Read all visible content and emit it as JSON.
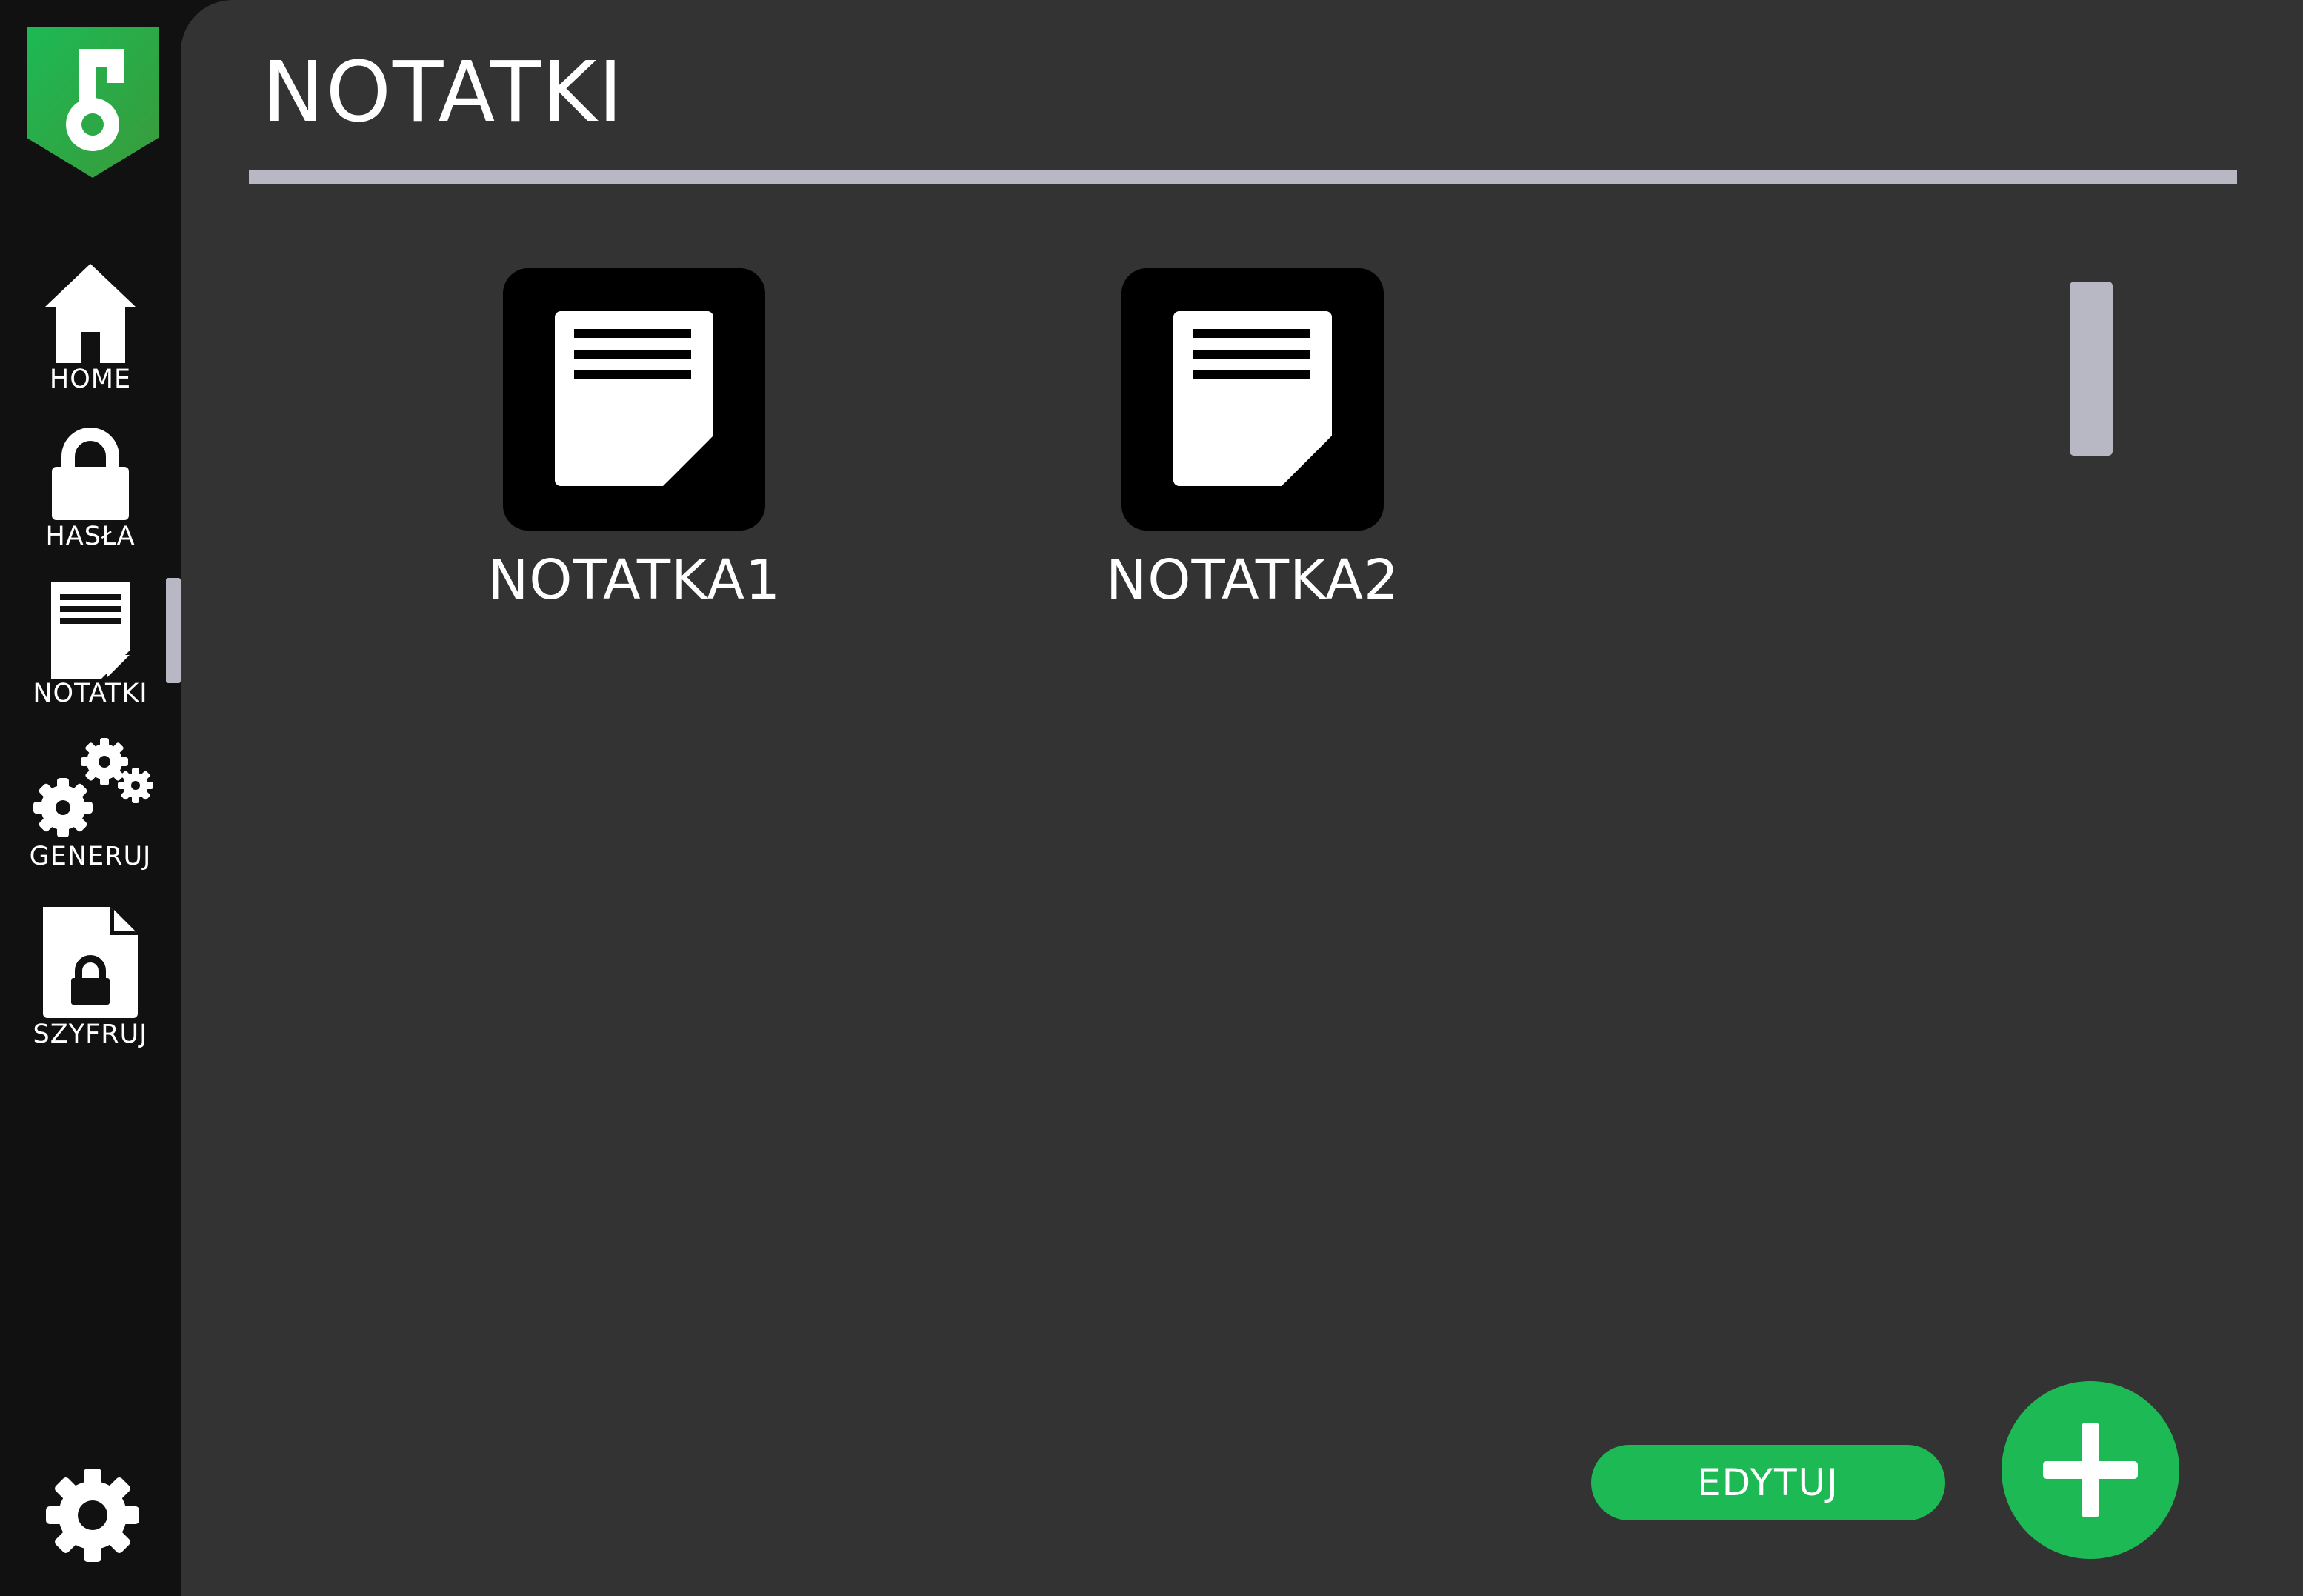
{
  "colors": {
    "accent": "#1db954",
    "sidebar_bg": "#111111",
    "content_bg": "#333333",
    "divider": "#b8b8c4",
    "tile_bg": "#000000",
    "text": "#ffffff"
  },
  "logo": {
    "icon": "key-shield-icon"
  },
  "sidebar": {
    "items": [
      {
        "label": "HOME",
        "icon": "home-icon",
        "active": false
      },
      {
        "label": "HASŁA",
        "icon": "lock-icon",
        "active": false
      },
      {
        "label": "NOTATKI",
        "icon": "note-icon",
        "active": true
      },
      {
        "label": "GENERUJ",
        "icon": "gears-icon",
        "active": false
      },
      {
        "label": "SZYFRUJ",
        "icon": "encrypted-file-icon",
        "active": false
      }
    ],
    "settings_icon": "gear-icon"
  },
  "main": {
    "title": "NOTATKI",
    "notes": [
      {
        "name": "NOTATKA1",
        "icon": "note-icon"
      },
      {
        "name": "NOTATKA2",
        "icon": "note-icon"
      }
    ],
    "edit_label": "EDYTUJ",
    "add_icon": "plus-icon"
  }
}
